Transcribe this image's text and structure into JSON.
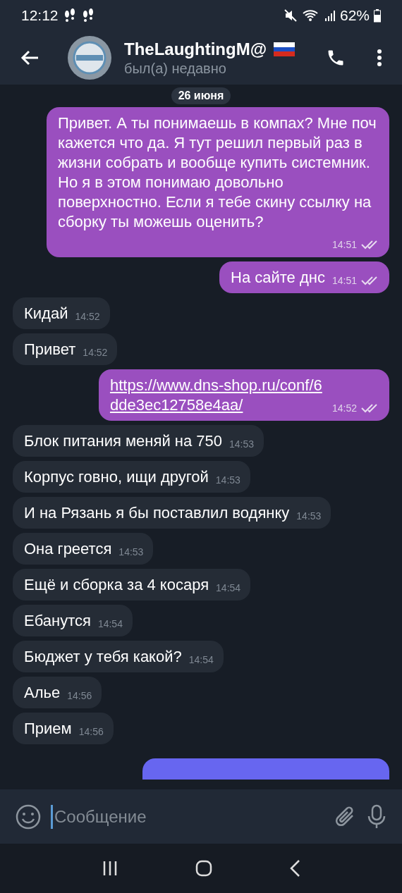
{
  "status_bar": {
    "time": "12:12",
    "battery": "62%"
  },
  "header": {
    "title": "TheLaughtingM@",
    "subtitle": "был(а) недавно"
  },
  "date_pill": "26 июня",
  "messages": [
    {
      "outgoing": true,
      "kind": "text",
      "text": "Привет. А ты понимаешь в компах? Мне поч кажется что да. Я тут решил первый раз в жизни собрать и вообще купить системник. Но я в этом понимаю довольно поверхностно. Если я тебе скину ссылку на сборку ты можешь оценить?",
      "time": "14:51",
      "read": true
    },
    {
      "outgoing": true,
      "kind": "text",
      "text": "На сайте днс",
      "time": "14:51",
      "read": true
    },
    {
      "outgoing": false,
      "kind": "text",
      "text": "Кидай",
      "time": "14:52"
    },
    {
      "outgoing": false,
      "kind": "text",
      "text": "Привет",
      "time": "14:52"
    },
    {
      "outgoing": true,
      "kind": "link",
      "text": "https://www.dns-shop.ru/conf/6dde3ec12758e4aa/",
      "time": "14:52",
      "read": true
    },
    {
      "outgoing": false,
      "kind": "text",
      "text": "Блок питания меняй на 750",
      "time": "14:53"
    },
    {
      "outgoing": false,
      "kind": "text",
      "text": "Корпус говно, ищи другой",
      "time": "14:53"
    },
    {
      "outgoing": false,
      "kind": "text",
      "text": "И на Рязань я бы поставлил водянку",
      "time": "14:53"
    },
    {
      "outgoing": false,
      "kind": "text",
      "text": "Она греется",
      "time": "14:53"
    },
    {
      "outgoing": false,
      "kind": "text",
      "text": "Ещё и сборка за 4 косаря",
      "time": "14:54"
    },
    {
      "outgoing": false,
      "kind": "text",
      "text": "Ебанутся",
      "time": "14:54"
    },
    {
      "outgoing": false,
      "kind": "text",
      "text": "Бюджет у тебя какой?",
      "time": "14:54"
    },
    {
      "outgoing": false,
      "kind": "text",
      "text": "Алье",
      "time": "14:56"
    },
    {
      "outgoing": false,
      "kind": "text",
      "text": "Прием",
      "time": "14:56"
    }
  ],
  "composer": {
    "placeholder": "Сообщение"
  }
}
